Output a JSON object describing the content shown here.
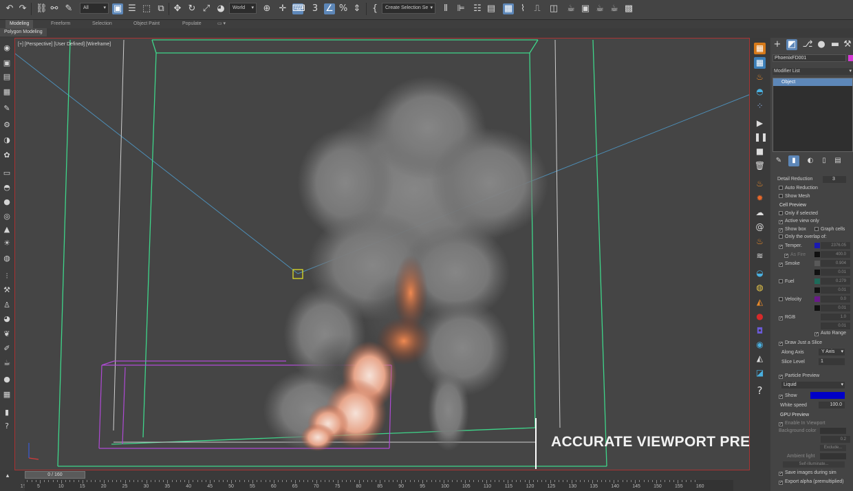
{
  "toolbar": {
    "filter_dropdown": "All",
    "coord_dropdown": "World",
    "selection_set_dropdown": "Create Selection Se"
  },
  "ribbon": {
    "tabs": [
      "Modeling",
      "Freeform",
      "Selection",
      "Object Paint",
      "Populate"
    ],
    "active_tab": "Modeling",
    "sub_tab": "Polygon Modeling"
  },
  "viewport": {
    "label": "[+] [Perspective] [User Defined] [Wireframe]",
    "overlay_caption": "ACCURATE VIEWPORT PREVIEW"
  },
  "command_panel": {
    "object_name": "PhoenixFD001",
    "modifier_list": "Modifier List",
    "stack_item": "Object",
    "detail_reduction_label": "Detail Reduction",
    "detail_reduction_value": "3",
    "auto_reduction": "Auto Reduction",
    "show_mesh": "Show Mesh",
    "cell_preview": "Cell Preview",
    "only_if_selected": "Only if selected",
    "active_view_only": "Active view only",
    "show_box": "Show box",
    "graph_cells": "Graph cells",
    "only_overlap": "Only the overlap of:",
    "channels": [
      {
        "label": "Temper.",
        "value": "2376.05",
        "color": "#1a1ab0"
      },
      {
        "label": "As Fire",
        "value": "400.0",
        "color": "#111111"
      },
      {
        "label": "Smoke",
        "value": "0.904",
        "color": "#5a5a5a"
      },
      {
        "label": "",
        "value": "0.01",
        "color": "#111111"
      },
      {
        "label": "Fuel",
        "value": "0.279",
        "color": "#1e6b5a"
      },
      {
        "label": "",
        "value": "0.01",
        "color": "#111111"
      },
      {
        "label": "Velocity",
        "value": "0.0",
        "color": "#6a1a8a"
      },
      {
        "label": "",
        "value": "0.01",
        "color": "#111111"
      },
      {
        "label": "RGB",
        "value": "1.0",
        "color": "#3a3a3a"
      },
      {
        "label": "",
        "value": "0.01",
        "color": "#3a3a3a"
      }
    ],
    "auto_range": "Auto Range",
    "draw_just_slice": "Draw Just a Slice",
    "along_axis_label": "Along Axis",
    "along_axis_value": "Y Axis",
    "slice_level_label": "Slice Level",
    "slice_level_value": "1",
    "particle_preview": "Particle Preview",
    "particle_type": "Liquid",
    "show_label": "Show",
    "show_color": "#0000c8",
    "white_speed_label": "White speed",
    "white_speed_value": "100.0",
    "gpu_preview": "GPU Preview",
    "enable_in_viewport": "Enable In Viewport",
    "background_color": "Background color",
    "gpu_value": "0.2",
    "exclude": "Exclude...",
    "ambient_light": "Ambient light",
    "self_illuminate": "Self-Illuminate...",
    "save_images": "Save images during sim",
    "export_alpha": "Export alpha (premultiplied)"
  },
  "timeline": {
    "frame_counter": "0 / 160",
    "ticks": [
      "5",
      "10",
      "15",
      "20",
      "25",
      "30",
      "35",
      "40",
      "45",
      "50",
      "55",
      "60",
      "65",
      "70",
      "75",
      "80",
      "85",
      "90",
      "95",
      "100",
      "105",
      "110",
      "115",
      "120",
      "125",
      "130",
      "135",
      "140",
      "145",
      "150",
      "155",
      "160"
    ]
  },
  "colors": {
    "accent": "#5d87b8",
    "viewport_border": "#aa3333",
    "bbox_green": "#3ed68a",
    "bbox_purple": "#b04ad6"
  }
}
